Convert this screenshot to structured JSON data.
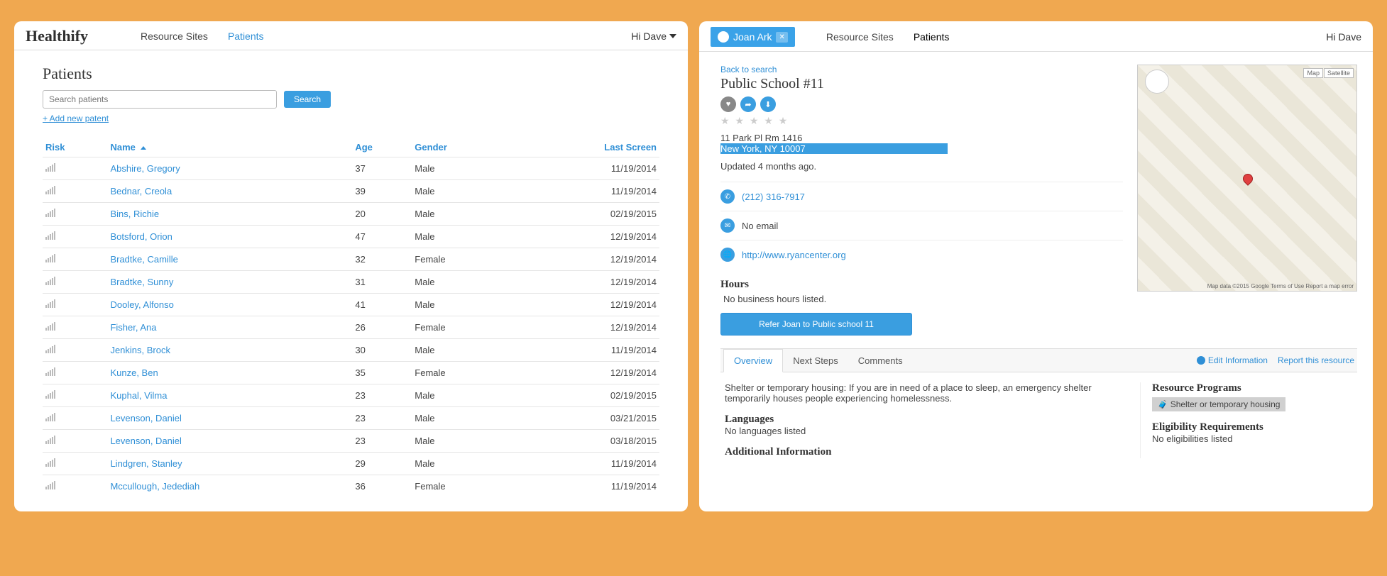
{
  "left": {
    "brand": "Healthify",
    "nav": {
      "resource_sites": "Resource Sites",
      "patients": "Patients"
    },
    "greeting": "Hi Dave",
    "page_title": "Patients",
    "search_placeholder": "Search patients",
    "search_button": "Search",
    "add_link": "+ Add new patent",
    "columns": {
      "risk": "Risk",
      "name": "Name",
      "age": "Age",
      "gender": "Gender",
      "last_screen": "Last Screen"
    },
    "rows": [
      {
        "name": "Abshire, Gregory",
        "age": "37",
        "gender": "Male",
        "last_screen": "11/19/2014"
      },
      {
        "name": "Bednar, Creola",
        "age": "39",
        "gender": "Male",
        "last_screen": "11/19/2014"
      },
      {
        "name": "Bins, Richie",
        "age": "20",
        "gender": "Male",
        "last_screen": "02/19/2015"
      },
      {
        "name": "Botsford, Orion",
        "age": "47",
        "gender": "Male",
        "last_screen": "12/19/2014"
      },
      {
        "name": "Bradtke, Camille",
        "age": "32",
        "gender": "Female",
        "last_screen": "12/19/2014"
      },
      {
        "name": "Bradtke, Sunny",
        "age": "31",
        "gender": "Male",
        "last_screen": "12/19/2014"
      },
      {
        "name": "Dooley, Alfonso",
        "age": "41",
        "gender": "Male",
        "last_screen": "12/19/2014"
      },
      {
        "name": "Fisher, Ana",
        "age": "26",
        "gender": "Female",
        "last_screen": "12/19/2014"
      },
      {
        "name": "Jenkins, Brock",
        "age": "30",
        "gender": "Male",
        "last_screen": "11/19/2014"
      },
      {
        "name": "Kunze, Ben",
        "age": "35",
        "gender": "Female",
        "last_screen": "12/19/2014"
      },
      {
        "name": "Kuphal, Vilma",
        "age": "23",
        "gender": "Male",
        "last_screen": "02/19/2015"
      },
      {
        "name": "Levenson, Daniel",
        "age": "23",
        "gender": "Male",
        "last_screen": "03/21/2015"
      },
      {
        "name": "Levenson, Daniel",
        "age": "23",
        "gender": "Male",
        "last_screen": "03/18/2015"
      },
      {
        "name": "Lindgren, Stanley",
        "age": "29",
        "gender": "Male",
        "last_screen": "11/19/2014"
      },
      {
        "name": "Mccullough, Jedediah",
        "age": "36",
        "gender": "Female",
        "last_screen": "11/19/2014"
      }
    ]
  },
  "right": {
    "nav": {
      "resource_sites": "Resource Sites",
      "patients": "Patients"
    },
    "greeting": "Hi Dave",
    "current_patient": "Joan Ark",
    "back_link": "Back to search",
    "resource_title": "Public School #11",
    "address_line1": "11 Park Pl Rm 1416",
    "address_line2": "New York, NY 10007",
    "updated_text": "Updated 4 months ago.",
    "phone": "(212) 316-7917",
    "email": "No email",
    "website": "http://www.ryancenter.org",
    "hours_heading": "Hours",
    "hours_body": "No business hours listed.",
    "refer_button": "Refer Joan to Public school 11",
    "map": {
      "type_map": "Map",
      "type_sat": "Satellite",
      "attribution": "Map data ©2015 Google   Terms of Use   Report a map error"
    },
    "tabs": {
      "overview": "Overview",
      "next_steps": "Next Steps",
      "comments": "Comments"
    },
    "tab_links": {
      "edit": "Edit Information",
      "report": "Report this resource"
    },
    "overview": {
      "description": "Shelter or temporary housing: If you are in need of a place to sleep, an emergency shelter temporarily houses people experiencing homelessness.",
      "languages_heading": "Languages",
      "languages_body": "No languages listed",
      "additional_heading": "Additional Information",
      "programs_heading": "Resource Programs",
      "program_chip": "Shelter or temporary housing",
      "eligibility_heading": "Eligibility Requirements",
      "eligibility_body": "No eligibilities listed"
    }
  }
}
